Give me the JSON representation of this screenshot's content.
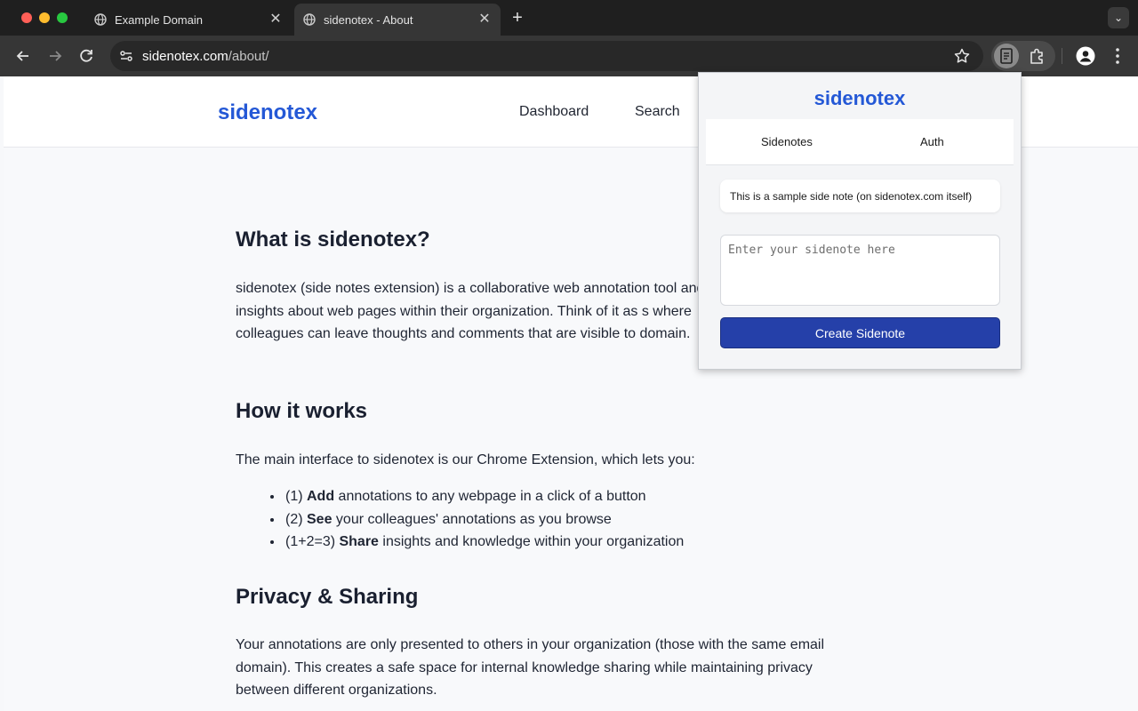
{
  "browser": {
    "tabs": [
      {
        "title": "Example Domain",
        "active": false
      },
      {
        "title": "sidenotex - About",
        "active": true
      }
    ],
    "url_host": "sidenotex.com",
    "url_path": "/about/"
  },
  "site": {
    "logo": "sidenotex",
    "nav": [
      "Dashboard",
      "Search"
    ]
  },
  "content": {
    "section1": {
      "heading": "What is sidenotex?",
      "paragraph": "sidenotex (side notes extension) is a collaborative web annotation tool and insights about web pages within their organization. Think of it as s where colleagues can leave thoughts and comments that are visible to domain."
    },
    "section2": {
      "heading": "How it works",
      "intro": "The main interface to sidenotex is our Chrome Extension, which lets you:",
      "bullets": [
        {
          "prefix": "(1) ",
          "bold": "Add",
          "rest": " annotations to any webpage in a click of a button"
        },
        {
          "prefix": "(2) ",
          "bold": "See",
          "rest": " your colleagues' annotations as you browse"
        },
        {
          "prefix": "(1+2=3) ",
          "bold": "Share",
          "rest": " insights and knowledge within your organization"
        }
      ]
    },
    "section3": {
      "heading": "Privacy & Sharing",
      "paragraph": "Your annotations are only presented to others in your organization (those with the same email domain). This creates a safe space for internal knowledge sharing while maintaining privacy between different organizations."
    }
  },
  "popup": {
    "title": "sidenotex",
    "tabs": [
      "Sidenotes",
      "Auth"
    ],
    "note": "This is a sample side note (on sidenotex.com itself)",
    "input_placeholder": "Enter your sidenote here",
    "button_label": "Create Sidenote"
  },
  "colors": {
    "brand": "#2458d6",
    "button": "#2540a9",
    "chrome_dark": "#1f1f1f",
    "toolbar": "#363636"
  },
  "icons": [
    "globe-icon",
    "close-icon",
    "plus-icon",
    "chevron-down-icon",
    "back-arrow-icon",
    "forward-arrow-icon",
    "reload-icon",
    "site-info-icon",
    "star-icon",
    "sidenotex-extension-icon",
    "puzzle-icon",
    "profile-icon",
    "more-icon"
  ]
}
